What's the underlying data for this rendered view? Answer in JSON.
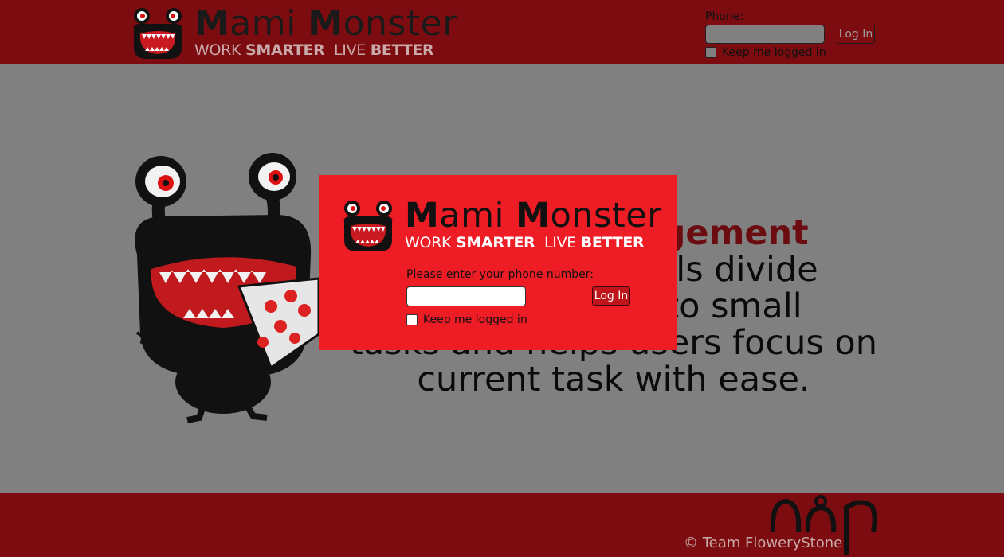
{
  "brand": {
    "name_first_cap": "M",
    "name_first_rest": "ami",
    "name_second_cap": "M",
    "name_second_rest": "onster",
    "tagline_work": "WORK",
    "tagline_smarter": "SMARTER",
    "tagline_live": "LIVE",
    "tagline_better": "BETTER"
  },
  "header": {
    "phone_label": "Phone:",
    "phone_value": "",
    "login_label": "Log In",
    "keep_logged_label": "Keep me logged in"
  },
  "hero": {
    "highlight": "nagement",
    "line1": "viduals divide",
    "line2": "s into small",
    "line3": "tasks and helps users focus on",
    "line4": "current task with ease."
  },
  "modal": {
    "prompt": "Please enter your phone number:",
    "phone_value": "",
    "login_label": "Log In",
    "keep_logged_label": "Keep me logged in"
  },
  "footer": {
    "credit": "©  Team FloweryStone"
  },
  "colors": {
    "header_bg": "#7d0c10",
    "main_bg": "#808080",
    "modal_bg": "#ee1c25",
    "highlight": "#6b0c10"
  },
  "icons": {
    "small_mascot": "monster-logo-icon",
    "big_mascot": "monster-with-pizza-illustration",
    "team_mark": "floweryStone-mark-icon"
  }
}
